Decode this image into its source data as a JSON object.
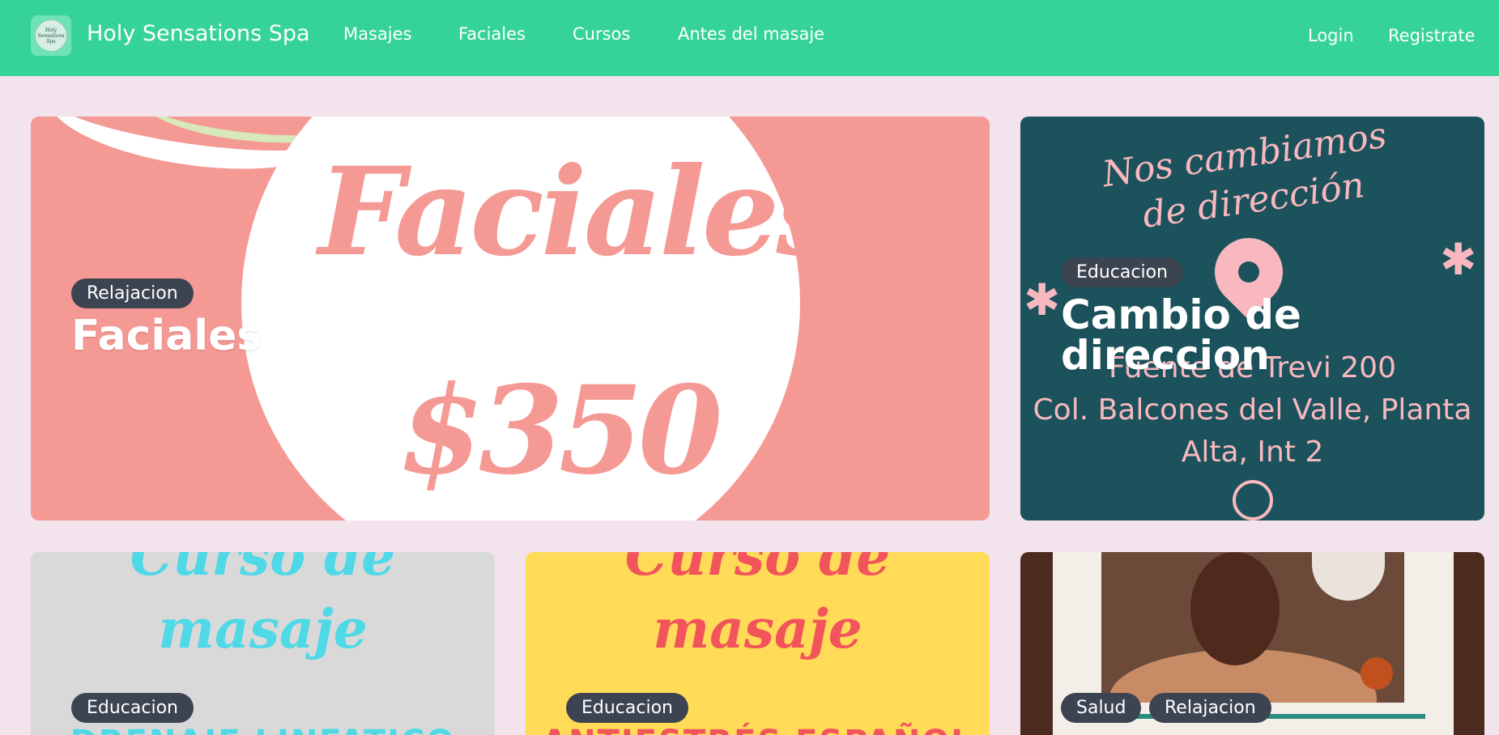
{
  "navbar": {
    "logo_text": "Holy Sensations Spa",
    "brand_name": "Holy Sensations Spa",
    "links": [
      "Masajes",
      "Faciales",
      "Cursos",
      "Antes del masaje"
    ],
    "login": "Login",
    "register": "Registrate"
  },
  "cards": [
    {
      "badges": [
        "Relajacion"
      ],
      "title": "Faciales",
      "image_text": {
        "word": "Faciales",
        "price": "$350"
      }
    },
    {
      "badges": [
        "Educacion"
      ],
      "title_line1": "Cambio de",
      "title_line2": "direccion",
      "image_text": {
        "heading1": "Nos cambiamos",
        "heading2": "de dirección",
        "address1": "Fuente de Trevi 200",
        "address2": "Col. Balcones del Valle, Planta",
        "address3": "Alta, Int 2"
      }
    },
    {
      "badges": [
        "Educacion"
      ],
      "image_text": {
        "line1": "Curso de",
        "line2": "masaje",
        "bottom": "DRENAJE LINFATICO"
      }
    },
    {
      "badges": [
        "Educacion"
      ],
      "image_text": {
        "line1": "Curso de",
        "line2": "masaje",
        "bottom": "ANTIESTRÉS ESPAÑOL"
      }
    },
    {
      "badges": [
        "Salud",
        "Relajacion"
      ]
    }
  ],
  "colors": {
    "navbar": "#36d399",
    "page_bg": "#f3e3ec",
    "badge_bg": "#3d4451",
    "faciales_bg": "#f59994",
    "cambio_bg": "#1b525c",
    "cambio_text": "#f9b8bf",
    "curso1_bg": "#d9d9d9",
    "curso1_text": "#4fd8e6",
    "curso2_bg": "#ffdb58",
    "curso2_text": "#f2545b"
  }
}
